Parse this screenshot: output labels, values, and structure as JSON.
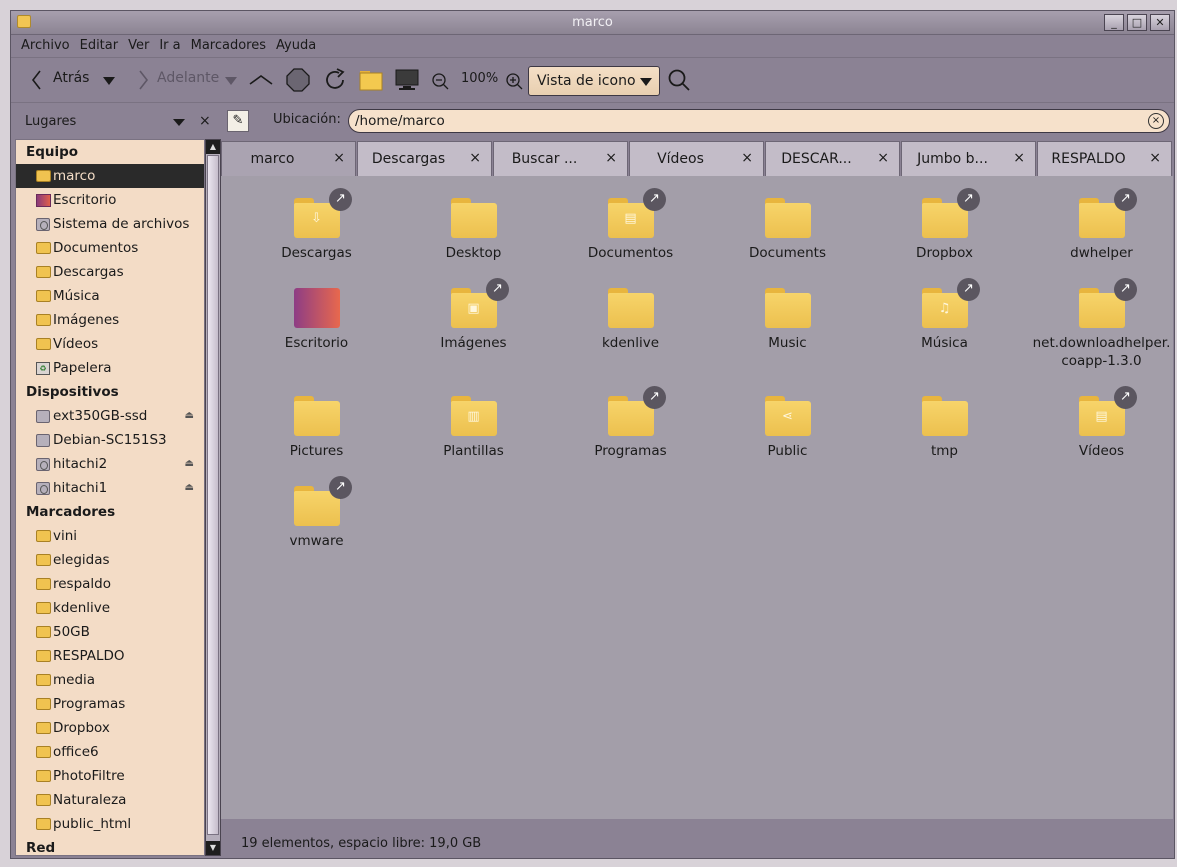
{
  "window": {
    "title": "marco",
    "min": "_",
    "max": "□",
    "close": "✕"
  },
  "menu": [
    "Archivo",
    "Editar",
    "Ver",
    "Ir a",
    "Marcadores",
    "Ayuda"
  ],
  "toolbar": {
    "back": "Atrás",
    "forward": "Adelante",
    "zoom": "100%",
    "view": "Vista de icono"
  },
  "sidebar": {
    "header": "Lugares",
    "close": "×",
    "sections": [
      {
        "title": "Equipo",
        "items": [
          {
            "label": "marco",
            "icon": "folder-icon",
            "selected": true
          },
          {
            "label": "Escritorio",
            "icon": "desktop-icon"
          },
          {
            "label": "Sistema de archivos",
            "icon": "drive-icon"
          },
          {
            "label": "Documentos",
            "icon": "folder-icon"
          },
          {
            "label": "Descargas",
            "icon": "folder-icon"
          },
          {
            "label": "Música",
            "icon": "folder-icon"
          },
          {
            "label": "Imágenes",
            "icon": "folder-icon"
          },
          {
            "label": "Vídeos",
            "icon": "folder-icon"
          },
          {
            "label": "Papelera",
            "icon": "trash-icon"
          }
        ]
      },
      {
        "title": "Dispositivos",
        "items": [
          {
            "label": "ext350GB-ssd",
            "icon": "drive-icon",
            "eject": true
          },
          {
            "label": "Debian-SC151S3",
            "icon": "drive-icon"
          },
          {
            "label": "hitachi2",
            "icon": "drive-icon",
            "eject": true
          },
          {
            "label": "hitachi1",
            "icon": "drive-icon",
            "eject": true
          }
        ]
      },
      {
        "title": "Marcadores",
        "items": [
          {
            "label": "vini",
            "icon": "folder-icon"
          },
          {
            "label": "elegidas",
            "icon": "folder-icon"
          },
          {
            "label": "respaldo",
            "icon": "folder-icon"
          },
          {
            "label": "kdenlive",
            "icon": "folder-icon"
          },
          {
            "label": "50GB",
            "icon": "folder-icon"
          },
          {
            "label": "RESPALDO",
            "icon": "folder-icon"
          },
          {
            "label": "media",
            "icon": "folder-icon"
          },
          {
            "label": "Programas",
            "icon": "folder-icon"
          },
          {
            "label": "Dropbox",
            "icon": "folder-icon"
          },
          {
            "label": "office6",
            "icon": "folder-icon"
          },
          {
            "label": "PhotoFiltre",
            "icon": "folder-icon"
          },
          {
            "label": "Naturaleza",
            "icon": "folder-icon"
          },
          {
            "label": "public_html",
            "icon": "folder-icon"
          }
        ]
      },
      {
        "title": "Red",
        "items": []
      }
    ]
  },
  "location": {
    "label": "Ubicación:",
    "value": "/home/marco"
  },
  "tabs": [
    {
      "label": "marco",
      "active": true
    },
    {
      "label": "Descargas"
    },
    {
      "label": "Buscar ..."
    },
    {
      "label": "Vídeos"
    },
    {
      "label": "DESCAR..."
    },
    {
      "label": "Jumbo b..."
    },
    {
      "label": "RESPALDO"
    }
  ],
  "tab_close": "×",
  "files": [
    {
      "label": "Descargas",
      "link": true,
      "emblem": "⇩"
    },
    {
      "label": "Desktop",
      "link": false,
      "emblem": ""
    },
    {
      "label": "Documentos",
      "link": true,
      "emblem": "▤"
    },
    {
      "label": "Documents",
      "link": false,
      "emblem": ""
    },
    {
      "label": "Dropbox",
      "link": true,
      "emblem": ""
    },
    {
      "label": "dwhelper",
      "link": true,
      "emblem": ""
    },
    {
      "label": "Escritorio",
      "link": false,
      "emblem": "",
      "desktop": true
    },
    {
      "label": "Imágenes",
      "link": true,
      "emblem": "▣"
    },
    {
      "label": "kdenlive",
      "link": false,
      "emblem": ""
    },
    {
      "label": "Music",
      "link": false,
      "emblem": ""
    },
    {
      "label": "Música",
      "link": true,
      "emblem": "♫"
    },
    {
      "label": "net.downloadhelper.coapp-1.3.0",
      "link": true,
      "emblem": ""
    },
    {
      "label": "Pictures",
      "link": false,
      "emblem": ""
    },
    {
      "label": "Plantillas",
      "link": false,
      "emblem": "▥"
    },
    {
      "label": "Programas",
      "link": true,
      "emblem": ""
    },
    {
      "label": "Public",
      "link": false,
      "emblem": "⋖"
    },
    {
      "label": "tmp",
      "link": false,
      "emblem": ""
    },
    {
      "label": "Vídeos",
      "link": true,
      "emblem": "▤"
    },
    {
      "label": "vmware",
      "link": true,
      "emblem": ""
    }
  ],
  "status": "19 elementos, espacio libre: 19,0  GB"
}
